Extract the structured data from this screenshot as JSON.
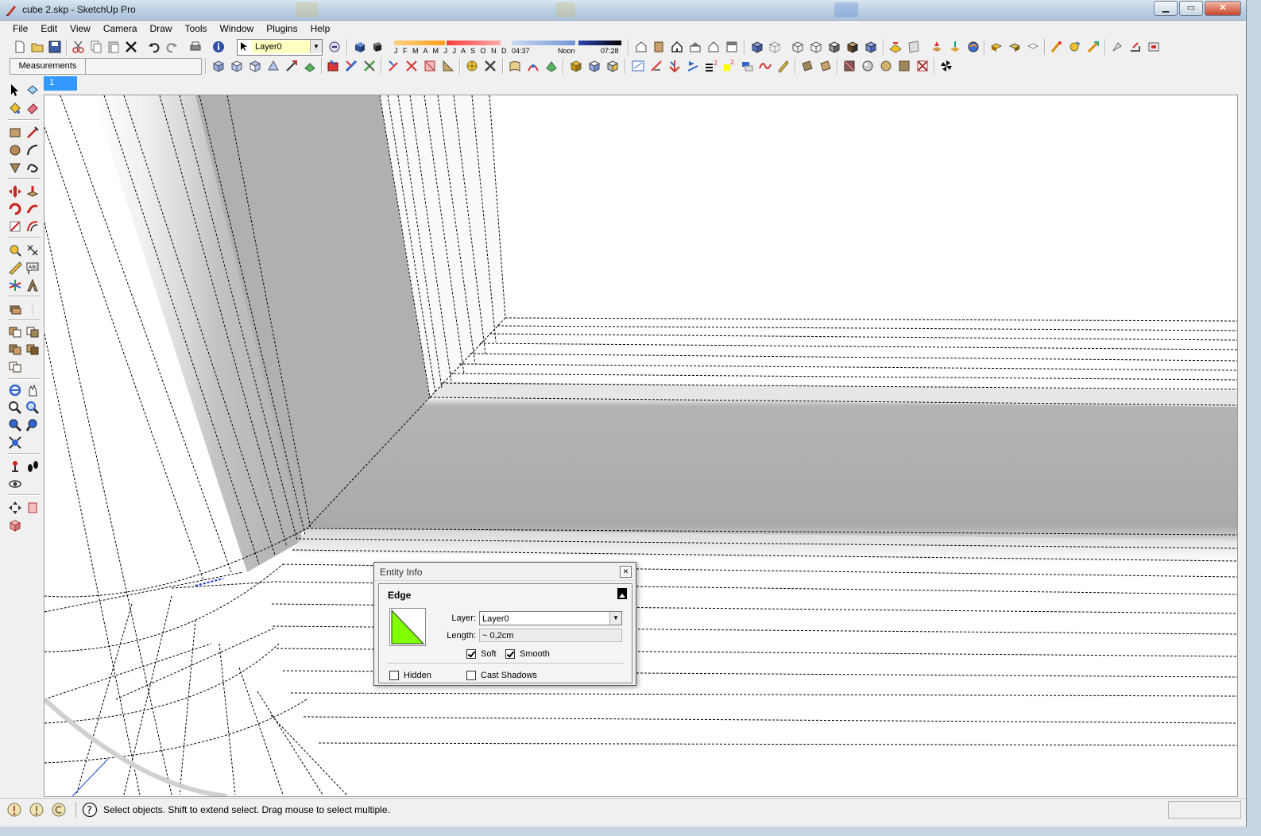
{
  "window": {
    "title": "cube 2.skp - SketchUp Pro",
    "controls": {
      "minimize": "▁",
      "maximize": "▭",
      "close": "✕"
    }
  },
  "menu": [
    "File",
    "Edit",
    "View",
    "Camera",
    "Draw",
    "Tools",
    "Window",
    "Plugins",
    "Help"
  ],
  "toolbar": {
    "layer_value": "Layer0",
    "shadow_months": "J F M A M J J A S O N D",
    "shadow_time_start": "04:37",
    "shadow_time_noon": "Noon",
    "shadow_time_end": "07:28",
    "measurements_label": "Measurements",
    "measurements_value": ""
  },
  "scene_tab": "1",
  "entity_info": {
    "title": "Entity Info",
    "close": "✕",
    "entity_type": "Edge",
    "layer_label": "Layer:",
    "layer_value": "Layer0",
    "length_label": "Length:",
    "length_value": "~ 0,2cm",
    "soft_label": "Soft",
    "soft_checked": true,
    "smooth_label": "Smooth",
    "smooth_checked": true,
    "hidden_label": "Hidden",
    "hidden_checked": false,
    "cast_shadows_label": "Cast Shadows",
    "cast_shadows_checked": false,
    "swatch_color": "#7fff00"
  },
  "status": {
    "help_icon": "?",
    "message": "Select objects. Shift to extend select. Drag mouse to select multiple."
  },
  "colors": {
    "accent": "#3399ff",
    "face_dark": "#b2b2b2",
    "face_light": "#ffffff"
  }
}
